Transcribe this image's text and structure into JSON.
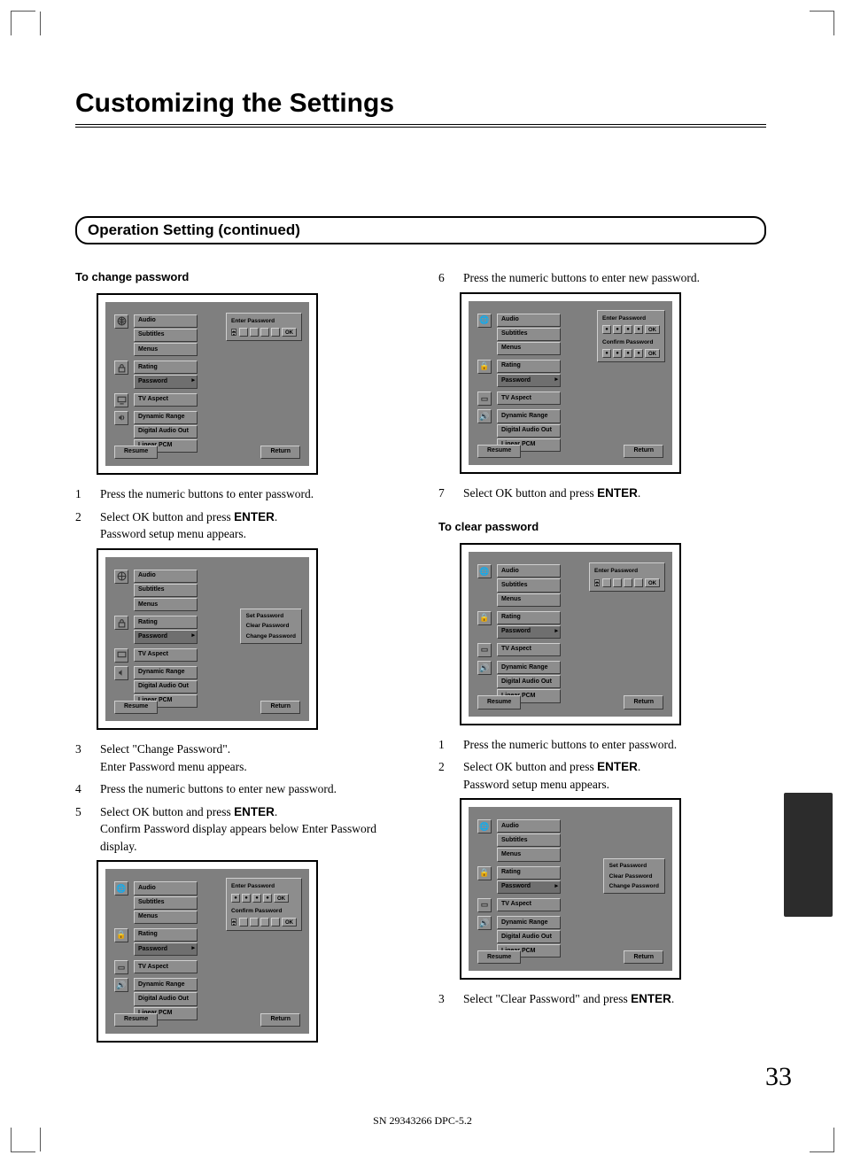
{
  "page_title": "Customizing the Settings",
  "section_title": "Operation Setting (continued)",
  "left": {
    "heading1": "To change password",
    "step1": "Press the numeric buttons to enter password.",
    "step2_a": "Select OK button and press ",
    "step2_b": "ENTER",
    "step2_c": ".",
    "step2_d": "Password setup menu appears.",
    "step3_a": "Select \"Change Password\".",
    "step3_b": "Enter Password menu appears.",
    "step4": "Press the numeric buttons to enter new password.",
    "step5_a": "Select OK button and press ",
    "step5_b": "ENTER",
    "step5_c": ".",
    "step5_d": "Confirm Password display appears below Enter Password display."
  },
  "right": {
    "step6": "Press the numeric buttons to enter new password.",
    "step7_a": "Select OK button and press ",
    "step7_b": "ENTER",
    "step7_c": ".",
    "heading2": "To clear password",
    "c_step1": "Press the numeric buttons to enter password.",
    "c_step2_a": "Select OK button and press ",
    "c_step2_b": "ENTER",
    "c_step2_c": ".",
    "c_step2_d": "Password setup menu appears.",
    "c_step3_a": "Select \"Clear Password\" and press ",
    "c_step3_b": "ENTER",
    "c_step3_c": "."
  },
  "osd": {
    "audio": "Audio",
    "subtitles": "Subtitles",
    "menus": "Menus",
    "rating": "Rating",
    "password": "Password",
    "tv_aspect": "TV Aspect",
    "dynamic_range": "Dynamic Range",
    "digital_audio_out": "Digital Audio Out",
    "linear_pcm": "Linear PCM",
    "resume": "Resume",
    "return": "Return",
    "enter_password": "Enter Password",
    "confirm_password": "Confirm Password",
    "ok": "OK",
    "set_password": "Set Password",
    "clear_password": "Clear Password",
    "change_password": "Change Password"
  },
  "page_number": "33",
  "footer": "SN 29343266 DPC-5.2"
}
